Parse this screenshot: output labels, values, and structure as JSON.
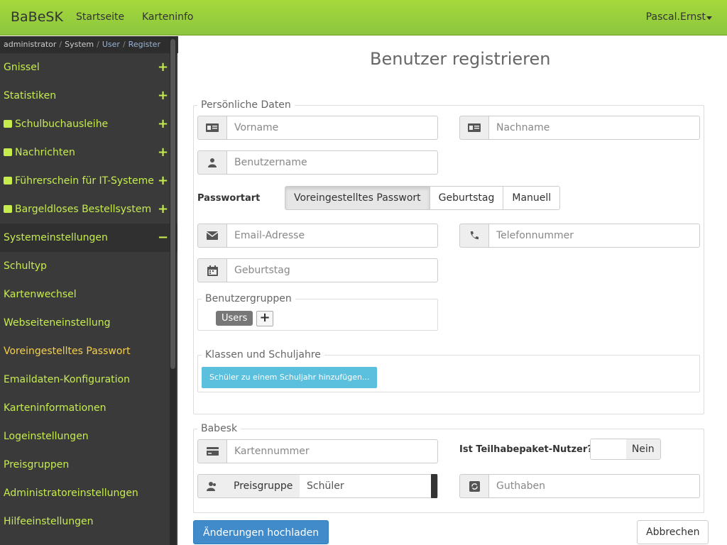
{
  "navbar": {
    "brand": "BaBeSK",
    "links": [
      "Startseite",
      "Karteninfo"
    ],
    "user": "Pascal.Ernst"
  },
  "breadcrumb": [
    "administrator",
    "System",
    "User",
    "Register"
  ],
  "sidebar": {
    "items": [
      {
        "label": "Gnissel",
        "icon": "",
        "state": "+"
      },
      {
        "label": "Statistiken",
        "icon": "",
        "state": "+"
      },
      {
        "label": "Schulbuchausleihe",
        "icon": "book-icon",
        "state": "+"
      },
      {
        "label": "Nachrichten",
        "icon": "message-icon",
        "state": "+"
      },
      {
        "label": "Führerschein für IT-Systeme",
        "icon": "license-icon",
        "state": "+"
      },
      {
        "label": "Bargeldloses Bestellsystem",
        "icon": "food-icon",
        "state": "+"
      },
      {
        "label": "Systemeinstellungen",
        "icon": "",
        "state": "−"
      }
    ],
    "subitems": [
      "Schultyp",
      "Kartenwechsel",
      "Webseiteneinstellung",
      "Voreingestelltes Passwort",
      "Emaildaten-Konfiguration",
      "Karteninformationen",
      "Logeinstellungen",
      "Preisgruppen",
      "Administratoreinstellungen",
      "Hilfeeinstellungen"
    ],
    "toggle": "◀"
  },
  "main": {
    "title": "Benutzer registrieren",
    "personal": {
      "legend": "Persönliche Daten",
      "firstname_placeholder": "Vorname",
      "lastname_placeholder": "Nachname",
      "username_placeholder": "Benutzername",
      "password_label": "Passwortart",
      "password_options": [
        "Voreingestelltes Passwort",
        "Geburtstag",
        "Manuell"
      ],
      "email_placeholder": "Email-Adresse",
      "phone_placeholder": "Telefonnummer",
      "birthday_placeholder": "Geburtstag",
      "groups_legend": "Benutzergruppen",
      "group_badge": "Users",
      "add_symbol": "+",
      "classes_legend": "Klassen und Schuljahre",
      "add_schoolyear_button": "Schüler zu einem Schuljahr hinzufügen..."
    },
    "babesk": {
      "legend": "Babesk",
      "card_placeholder": "Kartennummer",
      "participation_label": "Ist Teilhabepaket-Nutzer?",
      "participation_value": "Nein",
      "pricegroup_label": "Preisgruppe",
      "pricegroup_value": "Schüler",
      "credit_placeholder": "Guthaben"
    },
    "submit_button": "Änderungen hochladen",
    "cancel_button": "Abbrechen"
  },
  "colors": {
    "navbar": "#8cc63f",
    "sidebar_bg": "#3a3a3a",
    "sidebar_text": "#c6ec4e",
    "sidebar_active": "#f5d04a",
    "primary": "#428bca",
    "info": "#5bc0de"
  }
}
